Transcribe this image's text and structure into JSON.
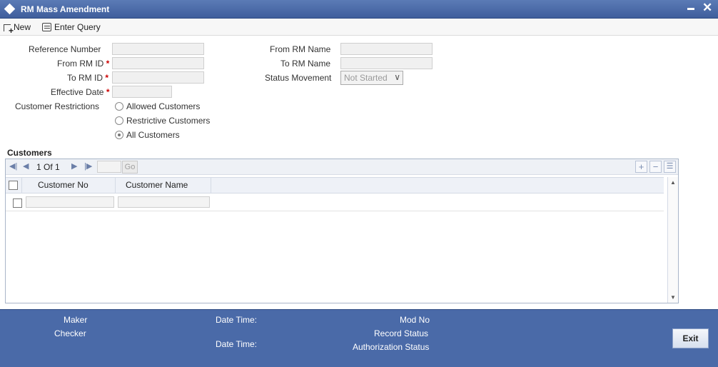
{
  "window": {
    "title": "RM Mass Amendment"
  },
  "toolbar": {
    "new_label": "New",
    "enter_query_label": "Enter Query"
  },
  "form": {
    "reference_number_label": "Reference Number",
    "from_rm_id_label": "From RM ID",
    "to_rm_id_label": "To RM ID",
    "effective_date_label": "Effective Date",
    "customer_restrictions_label": "Customer Restrictions",
    "from_rm_name_label": "From RM Name",
    "to_rm_name_label": "To RM Name",
    "status_movement_label": "Status Movement",
    "status_movement_value": "Not Started",
    "required_marker": "*",
    "restriction_options": [
      {
        "label": "Allowed Customers",
        "selected": false
      },
      {
        "label": "Restrictive Customers",
        "selected": false
      },
      {
        "label": "All Customers",
        "selected": true
      }
    ]
  },
  "customers": {
    "section_title": "Customers",
    "pager": {
      "current": "1",
      "of_label": "Of",
      "total": "1",
      "go_label": "Go"
    },
    "columns": [
      "Customer No",
      "Customer Name"
    ]
  },
  "footer": {
    "maker_label": "Maker",
    "checker_label": "Checker",
    "date_time_label_1": "Date Time:",
    "date_time_label_2": "Date Time:",
    "mod_no_label": "Mod No",
    "record_status_label": "Record Status",
    "authorization_status_label": "Authorization Status",
    "exit_label": "Exit"
  }
}
